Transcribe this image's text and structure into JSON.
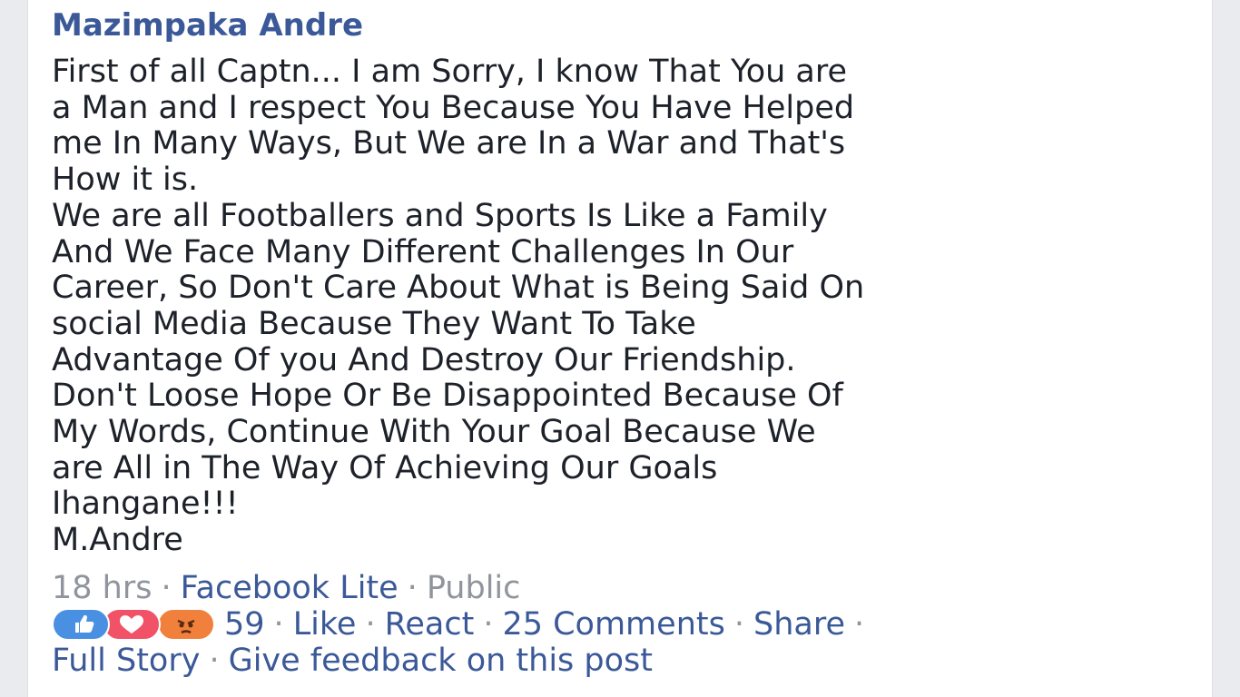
{
  "post": {
    "author": "Mazimpaka Andre",
    "body_lines": [
      "First of all Captn... I am Sorry, I know That You are",
      "a Man and I respect You Because You Have Helped",
      "me In Many Ways, But We are In a War and That's",
      "How it is.",
      "We are all Footballers and Sports Is Like a Family",
      "And We Face Many Different Challenges In Our",
      "Career, So Don't Care About What is Being Said On",
      "social Media Because They Want To Take",
      "Advantage Of you And Destroy Our Friendship.",
      "Don't Loose Hope Or Be Disappointed Because Of",
      "My Words, Continue With Your Goal Because We",
      "are All in The Way Of Achieving Our Goals",
      "Ihangane!!!",
      "M.Andre"
    ],
    "meta": {
      "time": "18 hrs",
      "source": "Facebook Lite",
      "privacy": "Public",
      "separator": "·"
    },
    "reactions": {
      "icons": [
        "like-icon",
        "love-icon",
        "angry-icon"
      ],
      "count": "59"
    },
    "actions": {
      "like": "Like",
      "react": "React",
      "comments": "25 Comments",
      "share": "Share",
      "full_story": "Full Story",
      "feedback": "Give feedback on this post"
    }
  },
  "colors": {
    "link": "#3b5998",
    "muted": "#90949c",
    "text": "#1d2129",
    "like": "#4a90e2",
    "love": "#f25268",
    "angry": "#f0803c"
  }
}
